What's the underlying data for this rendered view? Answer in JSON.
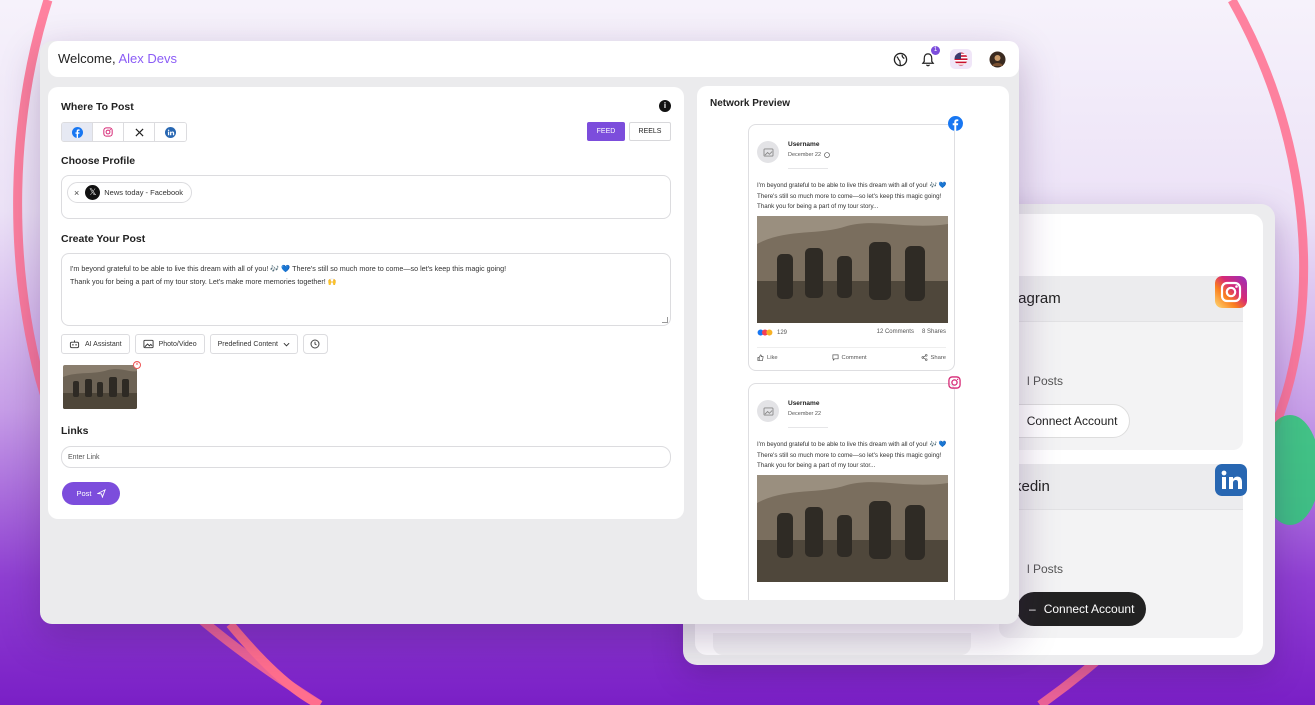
{
  "colors": {
    "accent": "#7c4ddc",
    "welcome_name": "#8b5cf6",
    "facebook": "#1877f2",
    "linkedin": "#2867b2",
    "arc": "#ff6b8a"
  },
  "header": {
    "welcome_prefix": "Welcome,",
    "user_name": "Alex Devs",
    "notification_count": "1",
    "icons": [
      "globe-icon",
      "bell-icon",
      "us-flag-icon",
      "user-avatar"
    ]
  },
  "composer": {
    "where_to_post_title": "Where To Post",
    "networks": [
      "facebook-icon",
      "instagram-icon",
      "x-icon",
      "linkedin-icon"
    ],
    "feed_label": "FEED",
    "reels_label": "REELS",
    "choose_profile_title": "Choose Profile",
    "profile_chip": "News today - Facebook",
    "create_post_title": "Create Your Post",
    "post_line1": "I'm beyond grateful to be able to live this dream with all of you! 🎶 💙 There's still so much more to come—so let's keep this magic going!",
    "post_line2": "Thank you for being a part of my tour story. Let's make more memories together! 🙌",
    "ai_assistant": "AI Assistant",
    "photo_video": "Photo/Video",
    "predefined_content": "Predefined Content",
    "links_title": "Links",
    "link_placeholder": "Enter Link",
    "post_button": "Post"
  },
  "preview": {
    "title": "Network Preview",
    "facebook_post": {
      "username": "Username",
      "date": "December 22",
      "text": "I'm beyond grateful to be able to live this dream with all of you! 🎶 💙 There's still so much more to come—so let's keep this magic going! Thank you for being a part of my tour story...",
      "reactions": "129",
      "comments": "12 Comments",
      "shares": "8 Shares",
      "like": "Like",
      "comment": "Comment",
      "share": "Share"
    },
    "instagram_post": {
      "username": "Username",
      "date": "December 22",
      "text": "I'm beyond grateful to be able to live this dream with all of you! 🎶 💙 There's still so much more to come—so let's keep this magic going! Thank you for being a part of my tour stor..."
    }
  },
  "accounts": {
    "instagram": {
      "name": "tagram",
      "posts": "l Posts",
      "button": "Connect Account"
    },
    "linkedin": {
      "name": "kedin",
      "posts": "l Posts",
      "button": "Connect Account"
    }
  }
}
